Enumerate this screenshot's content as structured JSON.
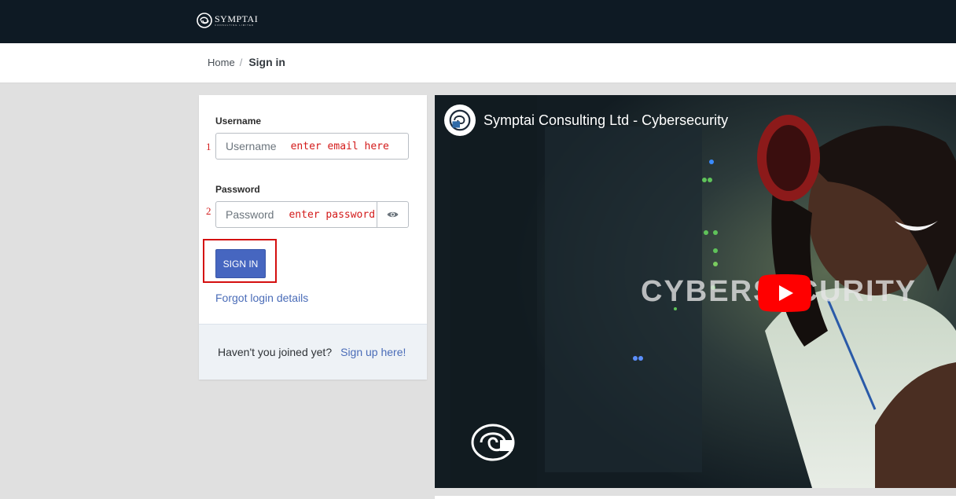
{
  "header": {
    "logo_text": "SYMPTAI",
    "logo_subtext": "CONSULTING LIMITED"
  },
  "breadcrumb": {
    "home": "Home",
    "separator": "/",
    "current": "Sign in"
  },
  "form": {
    "username_label": "Username",
    "username_placeholder": "Username",
    "username_number": "1",
    "username_hint": "enter email here",
    "password_label": "Password",
    "password_placeholder": "Password",
    "password_number": "2",
    "password_hint": "enter password",
    "eye_icon": "eye-icon",
    "signin_label": "SIGN IN",
    "forgot_label": "Forgot login details"
  },
  "footer": {
    "prompt": "Haven't you joined yet?",
    "signup_label": "Sign up here!"
  },
  "video": {
    "title": "Symptai Consulting Ltd - Cybersecurity",
    "overlay_text": "CYBERSECURITY",
    "play_icon": "youtube-play-icon"
  },
  "colors": {
    "topbar": "#0e1a24",
    "accent": "#4666c0",
    "link": "#4a6cb8",
    "annotation_red": "#d31a1a",
    "youtube_red": "#ff0000"
  }
}
